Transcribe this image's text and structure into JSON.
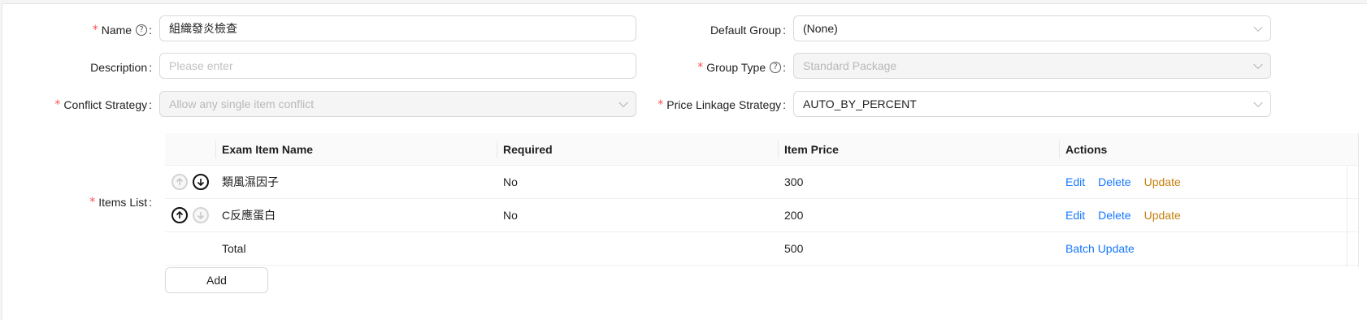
{
  "form": {
    "name": {
      "label": "Name",
      "value": "組織發炎檢查"
    },
    "description": {
      "label": "Description",
      "placeholder": "Please enter"
    },
    "conflict_strategy": {
      "label": "Conflict Strategy",
      "value": "Allow any single item conflict"
    },
    "default_group": {
      "label": "Default Group",
      "value": "(None)"
    },
    "group_type": {
      "label": "Group Type",
      "value": "Standard Package"
    },
    "price_linkage_strategy": {
      "label": "Price Linkage Strategy",
      "value": "AUTO_BY_PERCENT"
    },
    "items_list": {
      "label": "Items List"
    },
    "colon": ":"
  },
  "table": {
    "columns": [
      "Exam Item Name",
      "Required",
      "Item Price",
      "Actions"
    ],
    "rows": [
      {
        "name": "類風濕因子",
        "required": "No",
        "price": "300"
      },
      {
        "name": "C反應蛋白",
        "required": "No",
        "price": "200"
      }
    ],
    "actions": {
      "edit": "Edit",
      "delete": "Delete",
      "update": "Update"
    },
    "total": {
      "label": "Total",
      "price": "500",
      "batch_update": "Batch Update"
    }
  },
  "add_button": "Add",
  "colors": {
    "required_star": "#ff4d4f",
    "link": "#1677ff",
    "update_link": "#c4800c"
  }
}
